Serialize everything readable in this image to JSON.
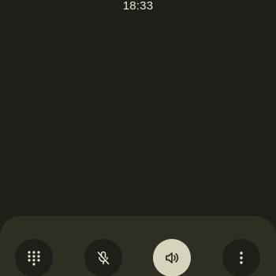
{
  "status_bar": {
    "time": "18:33"
  },
  "call_controls": {
    "buttons": [
      {
        "id": "dialpad",
        "icon": "dialpad-icon",
        "active": false
      },
      {
        "id": "mute",
        "icon": "mic-off-icon",
        "active": false
      },
      {
        "id": "speaker",
        "icon": "speaker-icon",
        "active": true
      },
      {
        "id": "more",
        "icon": "more-vert-icon",
        "active": false
      }
    ]
  },
  "colors": {
    "background": "#1e1f18",
    "panel": "#2f2e23",
    "icon": "#e6e4d6",
    "active_button": "#d7d4bd",
    "active_icon": "#2a2a1f"
  }
}
